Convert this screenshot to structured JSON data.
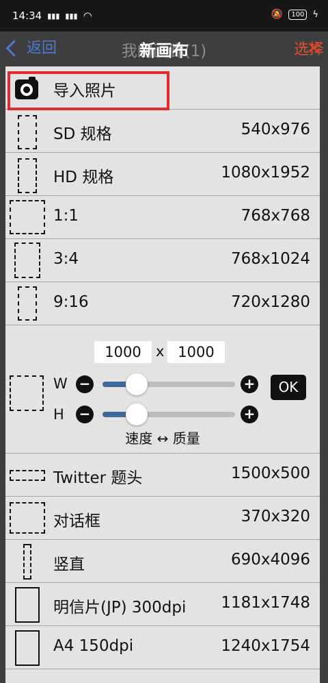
{
  "status_bar": {
    "time": "14:34",
    "signal_1": "4G",
    "signal_2": "4G",
    "battery": "100",
    "icons": [
      "signal-icon",
      "signal-icon",
      "wifi-icon",
      "mute-icon",
      "battery-icon",
      "charging-icon"
    ]
  },
  "header": {
    "back_label": "返回",
    "underlying_title": "我的画廊(1)",
    "select_label": "选择",
    "dialog_title": "新画布"
  },
  "import_photo": {
    "label": "导入照片",
    "icon": "camera-icon"
  },
  "presets": [
    {
      "label": "SD 规格",
      "value": "540x976"
    },
    {
      "label": "HD 规格",
      "value": "1080x1952"
    },
    {
      "label": "1:1",
      "value": "768x768"
    },
    {
      "label": "3:4",
      "value": "768x1024"
    },
    {
      "label": "9:16",
      "value": "720x1280"
    }
  ],
  "custom": {
    "width_value": "1000",
    "height_value": "1000",
    "separator": "x",
    "w_label": "W",
    "h_label": "H",
    "minus": "−",
    "plus": "+",
    "ok_label": "OK",
    "tradeoff_label": "速度 ↔ 质量",
    "w_slider_fraction": 0.26,
    "h_slider_fraction": 0.26
  },
  "presets_more": [
    {
      "label": "Twitter 题头",
      "value": "1500x500"
    },
    {
      "label": "对话框",
      "value": "370x320"
    },
    {
      "label": "竖直",
      "value": "690x4096"
    },
    {
      "label": "明信片(JP) 300dpi",
      "value": "1181x1748"
    },
    {
      "label": "A4 150dpi",
      "value": "1240x1754"
    }
  ],
  "colors": {
    "accent_blue": "#4a7bd0",
    "highlight_red": "#e22c2c",
    "slider_fill": "#3d6a9a"
  }
}
